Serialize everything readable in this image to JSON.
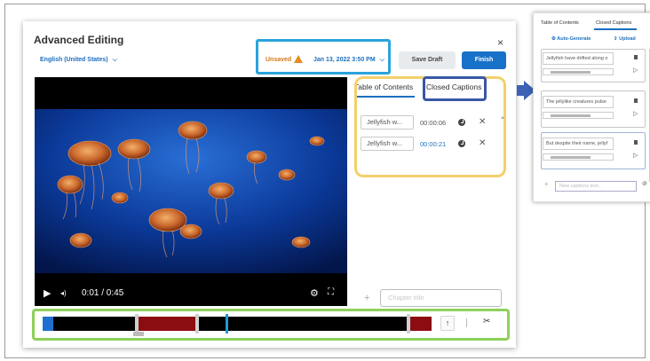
{
  "editor": {
    "title": "Advanced Editing",
    "language": "English (United States)",
    "status_unsaved": "Unsaved",
    "date": "Jan 13, 2022 3:50 PM",
    "save_draft_label": "Save Draft",
    "finish_label": "Finish",
    "close_symbol": "×"
  },
  "player": {
    "time": "0:01 / 0:45",
    "play_symbol": "▶",
    "volume_symbol": "◂)",
    "settings_symbol": "⚙",
    "fullscreen_symbol": "⛶"
  },
  "panel": {
    "tabs": [
      "Table of Contents",
      "Closed Captions"
    ],
    "active_tab": "Table of Contents",
    "chapters": [
      {
        "title": "Jellyfish w...",
        "time": "00:00:06"
      },
      {
        "title": "Jellyfish w...",
        "time": "00:00:21"
      }
    ],
    "delete_symbol": "✕",
    "add_symbol": "+",
    "chapter_placeholder": "Chapter title"
  },
  "timeline": {
    "up_symbol": "↑",
    "cut_symbol": "✂"
  },
  "cc_inset": {
    "tabs": [
      "Table of Contents",
      "Closed Captions"
    ],
    "active_tab": "Closed Captions",
    "auto_generate_label": "Auto-Generate",
    "upload_label": "Upload",
    "captions": [
      "Jellyfish have drifted along o",
      "The jellylike creatures pulse",
      "But despite their name, jellyf"
    ],
    "add_symbol": "+",
    "new_caption_placeholder": "New captions text...",
    "cancel_symbol": "⊘"
  },
  "colors": {
    "accent_blue": "#1871c8",
    "highlight_cyan": "#29a3dc",
    "highlight_yellow": "#f3d06b",
    "highlight_navy": "#3a57a6",
    "highlight_green": "#8ed05a",
    "cut_red": "#8b0d12",
    "warning_orange": "#e28b1e"
  }
}
